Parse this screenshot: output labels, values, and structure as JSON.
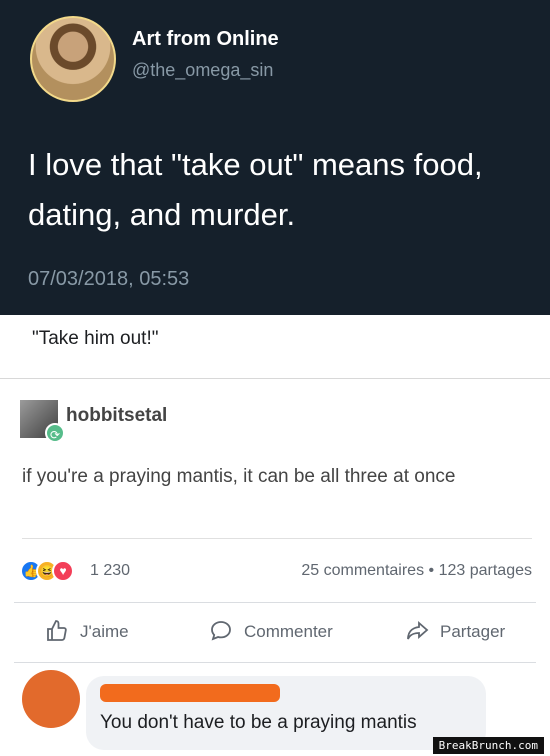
{
  "tweet": {
    "display_name": "Art from Online",
    "handle": "@the_omega_sin",
    "text": "I love that \"take out\" means food, dating, and murder.",
    "timestamp": "07/03/2018, 05:53",
    "background": "#15202b"
  },
  "caption": "\"Take him out!\"",
  "tumblr_post": {
    "username": "hobbitsetal",
    "text": "if you're a praying mantis, it can be all three at once",
    "badge_icon": "reblog-icon"
  },
  "reactions": {
    "icons": [
      "like-icon",
      "haha-icon",
      "love-icon"
    ],
    "count": "1 230",
    "comments": "25 commentaires",
    "separator": "•",
    "shares": "123 partages"
  },
  "actions": {
    "like_label": "J'aime",
    "comment_label": "Commenter",
    "share_label": "Partager"
  },
  "comment": {
    "text": "You don't have to be a praying mantis",
    "redaction_color": "#f26b1d"
  },
  "watermark": "BreakBrunch.com"
}
